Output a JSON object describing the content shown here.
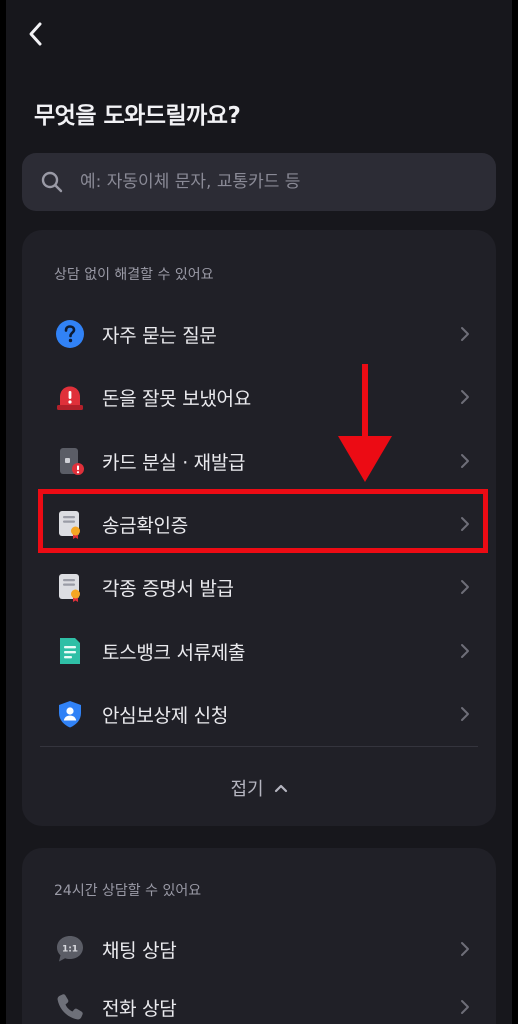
{
  "header": {
    "back_icon": "chevron-left-icon",
    "title": "무엇을 도와드릴까요?"
  },
  "search": {
    "icon": "search-icon",
    "placeholder": "예: 자동이체 문자, 교통카드 등",
    "value": ""
  },
  "self_service": {
    "caption": "상담 없이 해결할 수 있어요",
    "items": [
      {
        "label": "자주 묻는 질문",
        "icon": "question-circle-icon"
      },
      {
        "label": "돈을 잘못 보냈어요",
        "icon": "alarm-siren-icon"
      },
      {
        "label": "카드 분실 · 재발급",
        "icon": "lost-card-icon"
      },
      {
        "label": "송금확인증",
        "icon": "certificate-icon"
      },
      {
        "label": "각종 증명서 발급",
        "icon": "certificate-icon"
      },
      {
        "label": "토스뱅크 서류제출",
        "icon": "document-icon"
      },
      {
        "label": "안심보상제 신청",
        "icon": "shield-user-icon"
      }
    ],
    "collapse_label": "접기"
  },
  "consultation": {
    "caption": "24시간 상담할 수 있어요",
    "items": [
      {
        "label": "채팅 상담",
        "icon": "chat-bubble-icon",
        "badge": "1:1"
      },
      {
        "label": "전화 상담",
        "icon": "phone-icon"
      }
    ]
  },
  "colors": {
    "background": "#17171c",
    "card": "#202027",
    "search_bg": "#2c2c35",
    "accent_blue": "#3182f6",
    "alert_red": "#e0303a",
    "annotation_red": "#ec0b14"
  }
}
